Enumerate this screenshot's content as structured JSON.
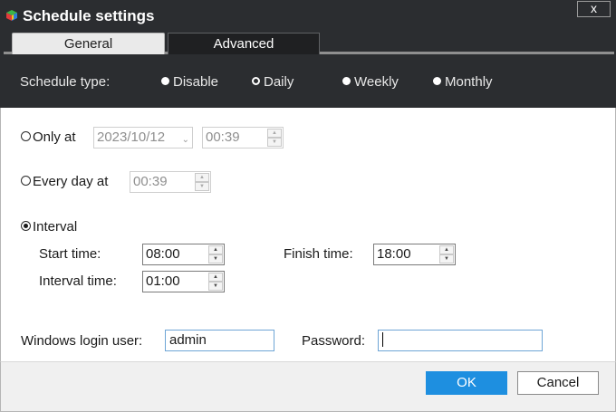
{
  "window": {
    "title": "Schedule settings",
    "close_label": "x"
  },
  "tabs": [
    {
      "label": "General",
      "selected": true
    },
    {
      "label": "Advanced",
      "selected": false
    }
  ],
  "schedule_type": {
    "label": "Schedule type:",
    "options": [
      {
        "label": "Disable",
        "selected": false
      },
      {
        "label": "Daily",
        "selected": true
      },
      {
        "label": "Weekly",
        "selected": false
      },
      {
        "label": "Monthly",
        "selected": false
      }
    ]
  },
  "only_at": {
    "label": "Only at",
    "checked": false,
    "date_value": "2023/10/12",
    "time_value": "00:39"
  },
  "every_day_at": {
    "label": "Every day at",
    "checked": false,
    "time_value": "00:39"
  },
  "interval": {
    "label": "Interval",
    "checked": true,
    "start_time_label": "Start time:",
    "start_time_value": "08:00",
    "finish_time_label": "Finish time:",
    "finish_time_value": "18:00",
    "interval_time_label": "Interval time:",
    "interval_time_value": "01:00"
  },
  "login": {
    "user_label": "Windows login user:",
    "user_value": "admin",
    "password_label": "Password:",
    "password_value": ""
  },
  "buttons": {
    "ok_label": "OK",
    "cancel_label": "Cancel"
  },
  "colors": {
    "title_bar": "#2b2d30",
    "accent": "#1e8fe0"
  }
}
